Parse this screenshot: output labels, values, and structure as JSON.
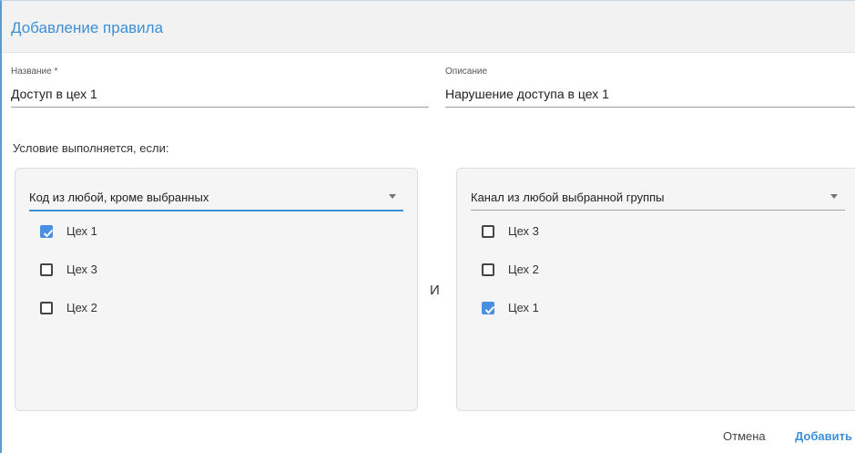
{
  "dialog": {
    "title": "Добавление правила"
  },
  "name_field": {
    "label": "Название *",
    "value": "Доступ в цех 1"
  },
  "description_field": {
    "label": "Описание",
    "value": "Нарушение доступа в цех 1"
  },
  "condition_label": "Условие выполняется, если:",
  "connector_label": "И",
  "left_panel": {
    "select_value": "Код из любой, кроме выбранных",
    "items": [
      {
        "label": "Цех 1",
        "checked": true
      },
      {
        "label": "Цех 3",
        "checked": false
      },
      {
        "label": "Цех 2",
        "checked": false
      }
    ]
  },
  "right_panel": {
    "select_value": "Канал из любой выбранной группы",
    "items": [
      {
        "label": "Цех 3",
        "checked": false
      },
      {
        "label": "Цех 2",
        "checked": false
      },
      {
        "label": "Цех 1",
        "checked": true
      }
    ]
  },
  "footer": {
    "cancel_label": "Отмена",
    "add_label": "Добавить"
  },
  "colors": {
    "accent": "#3d8fd6",
    "checkbox_checked": "#4a90e2"
  }
}
